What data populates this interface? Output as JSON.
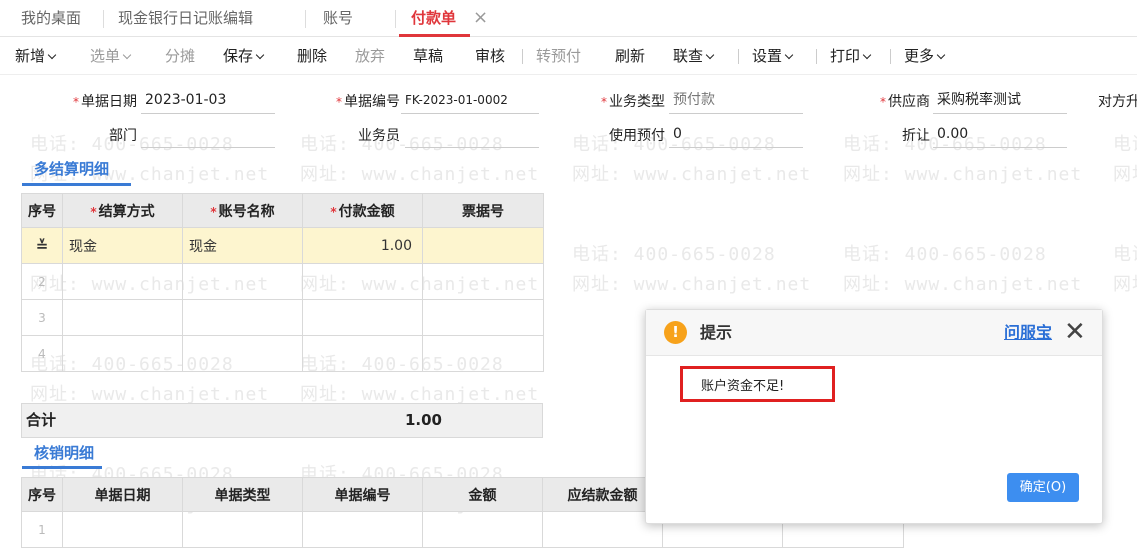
{
  "tabs": [
    {
      "label": "我的桌面"
    },
    {
      "label": "现金银行日记账编辑"
    },
    {
      "label": "账号"
    },
    {
      "label": "付款单",
      "active": true
    }
  ],
  "toolbar": {
    "add": "新增",
    "select_doc": "选单",
    "allocate": "分摊",
    "save": "保存",
    "delete": "删除",
    "abandon": "放弃",
    "draft": "草稿",
    "audit": "审核",
    "to_prepay": "转预付",
    "refresh": "刷新",
    "link_query": "联查",
    "settings": "设置",
    "print": "打印",
    "more": "更多"
  },
  "watermark": {
    "phone": "电话: 400-665-0028",
    "site": "网址: www.chanjet.net",
    "phone_part": "电话:",
    "site_part": "网址:"
  },
  "form": {
    "doc_date_label": "单据日期",
    "doc_date_value": "2023-01-03",
    "doc_no_label": "单据编号",
    "doc_no_value": "FK-2023-01-0002",
    "biz_type_label": "业务类型",
    "biz_type_value": "预付款",
    "supplier_label": "供应商",
    "supplier_value": "采购税率测试",
    "counterparty_label": "对方升",
    "dept_label": "部门",
    "dept_value": "",
    "staff_label": "业务员",
    "staff_value": "",
    "use_prepay_label": "使用预付",
    "use_prepay_value": "0",
    "discount_label": "折让",
    "discount_value": "0.00"
  },
  "settlement": {
    "title": "多结算明细",
    "headers": [
      "序号",
      "结算方式",
      "账号名称",
      "付款金额",
      "票据号"
    ],
    "rows": [
      {
        "idx": "",
        "method": "现金",
        "account": "现金",
        "amount": "1.00",
        "ticket": ""
      },
      {
        "idx": "2",
        "method": "",
        "account": "",
        "amount": "",
        "ticket": ""
      },
      {
        "idx": "3",
        "method": "",
        "account": "",
        "amount": "",
        "ticket": ""
      },
      {
        "idx": "4",
        "method": "",
        "account": "",
        "amount": "",
        "ticket": ""
      }
    ],
    "total_label": "合计",
    "total_value": "1.00"
  },
  "writeoff": {
    "title": "核销明细",
    "headers": [
      "序号",
      "单据日期",
      "单据类型",
      "单据编号",
      "金额",
      "应结款金额"
    ],
    "rows": [
      {
        "idx": "1"
      }
    ]
  },
  "dialog": {
    "title": "提示",
    "help_link": "问服宝",
    "message": "账户资金不足!",
    "ok_label": "确定(O)",
    "icon_glyph": "!"
  },
  "icons": {
    "tab_close": "×",
    "dialog_close": "✕",
    "row_op": "≚"
  }
}
